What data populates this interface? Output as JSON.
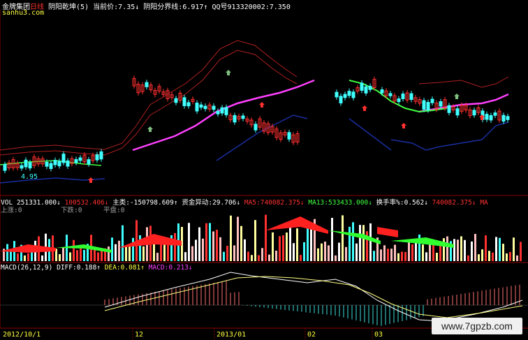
{
  "header": {
    "name": "金牌集团",
    "period": "日线",
    "indicator": "阴阳乾坤(5)",
    "cur_price_label": "当前价:",
    "cur_price": "7.35↓",
    "boundary_label": "阴阳分界线:",
    "boundary_value": "6.917↑",
    "qq_label": "QQ号913320002:",
    "qq_value": "7.350"
  },
  "site": "sanhu3.com",
  "price_label_low": "4.95",
  "vol_header": {
    "vol_label": "VOL",
    "vol_value": "251331.000↓",
    "red_value": "100532.406↓",
    "main_label": "主类:",
    "main_value": "-150798.609↑",
    "flow_label": "资金异动:",
    "flow_value": "29.706↓",
    "ma5_label": "MA5:",
    "ma5_value": "740082.375↓",
    "ma13_label": "MA13:",
    "ma13_value": "533433.000↓",
    "turnover_label": "换手率%:",
    "turnover_value": "0.562↓",
    "tail_value": "740082.375↓",
    "tail_label": "MA"
  },
  "vol_sub": {
    "up_label": "上涨:0",
    "down_label": "下跌:0",
    "flat_label": "平盘:0"
  },
  "macd_header": {
    "label": "MACD(26,12,9)",
    "diff_label": "DIFF:",
    "diff_value": "0.188↑",
    "dea_label": "DEA:",
    "dea_value": "0.081↑",
    "macd_label": "MACD:",
    "macd_value": "0.213↓"
  },
  "x_axis": {
    "labels": [
      "2012/10/1",
      "12",
      "2013/01",
      "02",
      "03"
    ]
  },
  "watermark": "www.7gpzb.com",
  "colors": {
    "up": "#ff3030",
    "down": "#40ffff",
    "ma_pink": "#ff40ff",
    "band_red": "#b02020",
    "band_blue": "#1a2ea0",
    "ma_green": "#40ff40"
  }
}
